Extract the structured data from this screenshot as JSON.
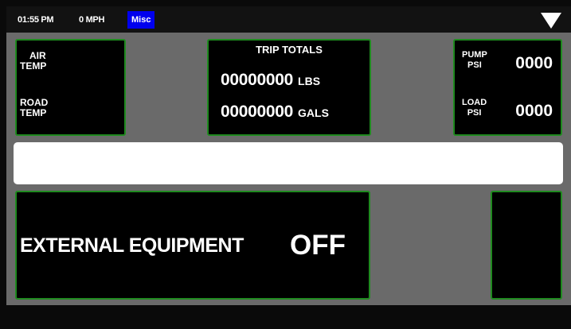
{
  "status_bar": {
    "time": "01:55 PM",
    "speed": "0 MPH",
    "mode": "Misc"
  },
  "temps": {
    "air_line1": "AIR",
    "air_line2": "TEMP",
    "road_line1": "ROAD",
    "road_line2": "TEMP"
  },
  "trip_totals": {
    "title": "TRIP TOTALS",
    "weight_value": "00000000",
    "weight_unit": "LBS",
    "volume_value": "00000000",
    "volume_unit": "GALS"
  },
  "pressures": {
    "pump_line1": "PUMP",
    "pump_line2": "PSI",
    "pump_value": "0000",
    "load_line1": "LOAD",
    "load_line2": "PSI",
    "load_value": "0000"
  },
  "message_bar": {
    "text": ""
  },
  "external_equipment": {
    "label": "EXTERNAL EQUIPMENT",
    "state": "OFF"
  },
  "colors": {
    "panel_border": "#1f8a1f",
    "mode_badge": "#0000ee",
    "background": "#6a6a6a"
  }
}
